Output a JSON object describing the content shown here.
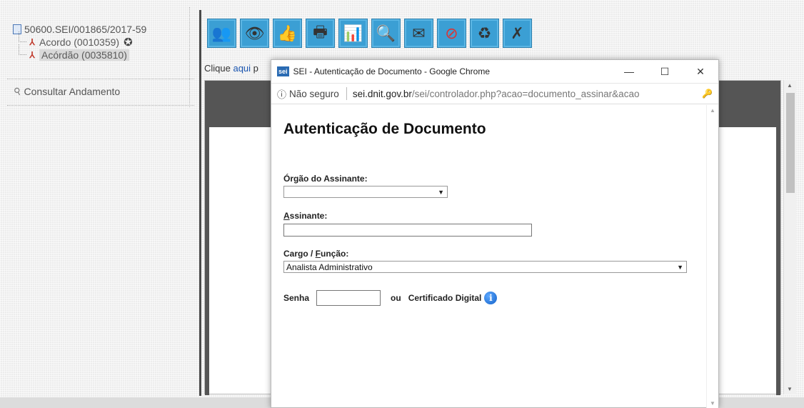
{
  "tree": {
    "process": "50600.SEI/001865/2017-59",
    "docs": [
      {
        "label": "Acordo (0010359)",
        "has_seal": true,
        "selected": false
      },
      {
        "label": "Acórdão (0035810)",
        "has_seal": false,
        "selected": true
      }
    ],
    "consult_label": "Consultar Andamento"
  },
  "toolbar": {
    "icons": [
      "users-icon",
      "eye-icon",
      "thumbs-up-icon",
      "print-icon",
      "graph-icon",
      "document-magnify-icon",
      "email-icon",
      "cancel-icon",
      "recycle-bin-icon",
      "remove-document-icon"
    ]
  },
  "hint": {
    "prefix": "Clique ",
    "link": "aqui",
    "suffix": " p"
  },
  "popup": {
    "title": "SEI - Autenticação de Documento - Google Chrome",
    "logo": "sei",
    "win_controls": {
      "minimize": "—",
      "maximize": "☐",
      "close": "✕"
    },
    "address": {
      "security": "Não seguro",
      "host": "sei.dnit.gov.br",
      "path": "/sei/controlador.php?acao=documento_assinar&acao"
    },
    "heading": "Autenticação de Documento",
    "orgao": {
      "label": "Órgão do Assinante:",
      "value": ""
    },
    "assinante": {
      "label_first": "A",
      "label_rest": "ssinante:",
      "value": ""
    },
    "cargo": {
      "label_pre": "Cargo / ",
      "label_u": "F",
      "label_post": "unção:",
      "value": "Analista Administrativo"
    },
    "senha": {
      "label": "Senha",
      "value": "",
      "or": "ou",
      "cert": "Certificado Digital"
    }
  },
  "colors": {
    "toolbar_blue": "#3b9fd4",
    "link_blue": "#1a55b0",
    "sei_blue": "#2a6bb3"
  }
}
